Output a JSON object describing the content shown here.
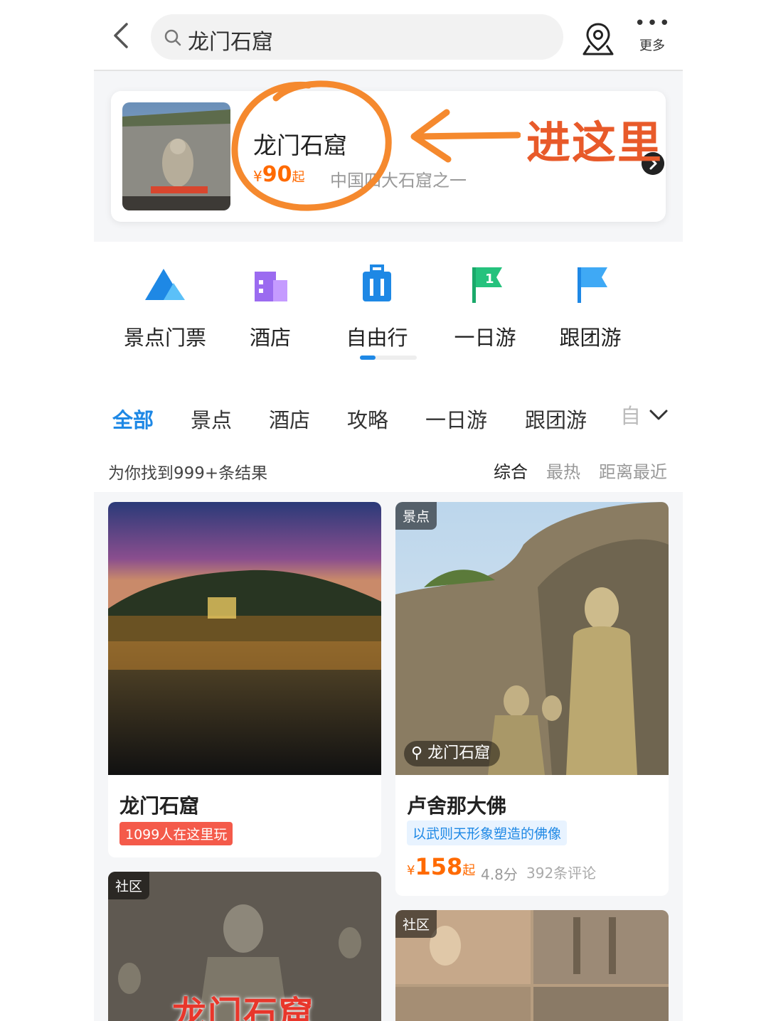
{
  "topbar": {
    "search_query": "龙门石窟",
    "more_label": "更多",
    "more_dots": "•••"
  },
  "scene_card": {
    "name": "龙门石窟",
    "price_currency": "¥",
    "price_value": "90",
    "price_suffix": "起",
    "description": "中国四大石窟之一",
    "annotation": "进这里"
  },
  "categories": [
    "景点门票",
    "酒店",
    "自由行",
    "一日游",
    "跟团游"
  ],
  "tabs": [
    "全部",
    "景点",
    "酒店",
    "攻略",
    "一日游",
    "跟团游"
  ],
  "tabs_more": "自",
  "results": {
    "count_text": "为你找到999+条结果",
    "sorts": [
      "综合",
      "最热",
      "距离最近"
    ]
  },
  "cards": [
    {
      "title": "龙门石窟",
      "badge": "1099人在这里玩"
    },
    {
      "tag": "景点",
      "location": "龙门石窟",
      "title": "卢舍那大佛",
      "badge": "以武则天形象塑造的佛像",
      "price_currency": "¥",
      "price_value": "158",
      "price_suffix": "起",
      "score": "4.8分",
      "reviews": "392条评论"
    },
    {
      "tag": "社区",
      "overlay_title": "龙门石窟"
    },
    {
      "tag": "社区"
    }
  ],
  "colors": {
    "accent": "#1e88e5",
    "price": "#ff6a00",
    "annotation": "#e85a2a",
    "badge_red": "#f45a4a"
  }
}
